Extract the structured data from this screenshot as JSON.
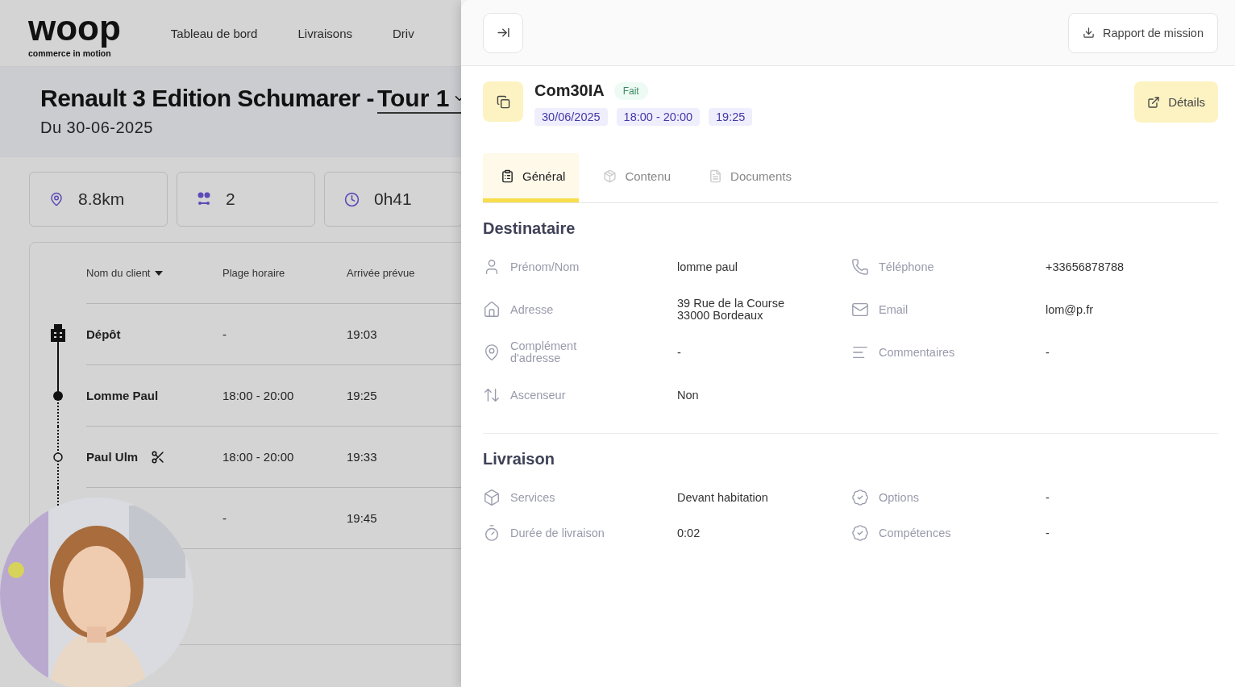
{
  "logo": {
    "wordmark": "woop",
    "tagline": "commerce in motion"
  },
  "nav": [
    "Tableau de bord",
    "Livraisons",
    "Driv"
  ],
  "tour": {
    "title": "Renault 3 Edition Schumarer -",
    "selector": "Tour 1",
    "date": "Du 30-06-2025"
  },
  "stats": [
    {
      "kind": "distance",
      "value": "8.8km"
    },
    {
      "kind": "stops",
      "value": "2"
    },
    {
      "kind": "duration",
      "value": "0h41"
    }
  ],
  "table": {
    "columns": [
      "Nom du client",
      "Plage horaire",
      "Arrivée prévue"
    ],
    "rows": [
      {
        "kind": "depot",
        "name": "Dépôt",
        "slot": "-",
        "arrival": "19:03",
        "split": false
      },
      {
        "kind": "done",
        "name": "Lomme Paul",
        "slot": "18:00 - 20:00",
        "arrival": "19:25",
        "split": false
      },
      {
        "kind": "pending",
        "name": "Paul Ulm",
        "slot": "18:00 - 20:00",
        "arrival": "19:33",
        "split": true
      },
      {
        "slot": "-",
        "arrival": "19:45"
      }
    ]
  },
  "webcam": {
    "kind": "picture"
  },
  "drawer": {
    "report_button": "Rapport de mission",
    "order": {
      "reference": "Com30IA",
      "status": "Fait",
      "chips": [
        "30/06/2025",
        "18:00 - 20:00",
        "19:25"
      ],
      "details_button": "Détails"
    },
    "tabs": [
      {
        "label": "Général",
        "selected": true
      },
      {
        "label": "Contenu",
        "selected": false
      },
      {
        "label": "Documents",
        "selected": false
      }
    ],
    "sections": [
      {
        "title": "Destinataire",
        "rows": [
          [
            {
              "label": "Prénom/Nom",
              "value": "lomme paul"
            },
            {
              "label": "Téléphone",
              "value": "+33656878788"
            }
          ],
          [
            {
              "label": "Adresse",
              "value": "39 Rue de la Course\n33000 Bordeaux"
            },
            {
              "label": "Email",
              "value": "lom@p.fr"
            }
          ],
          [
            {
              "label": "Complément\nd'adresse",
              "value": "-"
            },
            {
              "label": "Commentaires",
              "value": "-"
            }
          ],
          [
            {
              "label": "Ascenseur",
              "value": "Non"
            }
          ]
        ]
      },
      {
        "title": "Livraison",
        "rows": [
          [
            {
              "label": "Services",
              "value": "Devant habitation"
            },
            {
              "label": "Options",
              "value": "-"
            }
          ],
          [
            {
              "label": "Durée de livraison",
              "value": "0:02"
            },
            {
              "label": "Compétences",
              "value": "-"
            }
          ]
        ]
      }
    ]
  }
}
